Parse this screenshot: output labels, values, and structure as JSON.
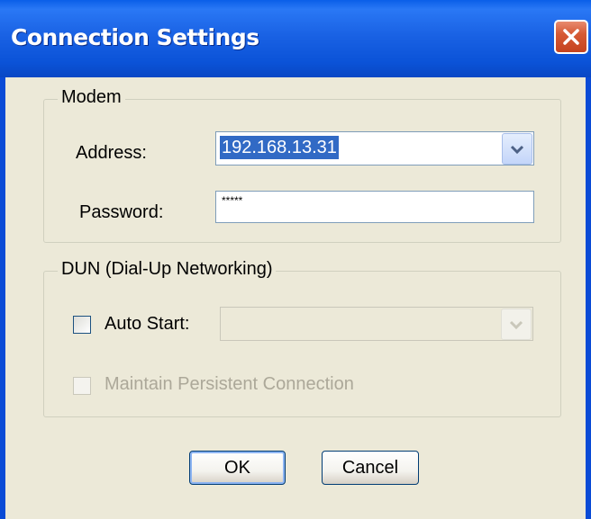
{
  "window": {
    "title": "Connection Settings"
  },
  "modem": {
    "legend": "Modem",
    "address_label": "Address:",
    "address_value": "192.168.13.31",
    "password_label": "Password:",
    "password_value": "*****"
  },
  "dun": {
    "legend": "DUN (Dial-Up Networking)",
    "auto_start_label": "Auto Start:",
    "auto_start_checked": false,
    "auto_start_value": "",
    "persistent_label": "Maintain Persistent Connection",
    "persistent_checked": false
  },
  "buttons": {
    "ok": "OK",
    "cancel": "Cancel"
  },
  "icons": {
    "close": "close-icon",
    "dropdown": "chevron-down-icon"
  },
  "colors": {
    "titlebar": "#0B53D8",
    "selection": "#316AC5",
    "close": "#D65A35",
    "face": "#ECE9D8"
  }
}
